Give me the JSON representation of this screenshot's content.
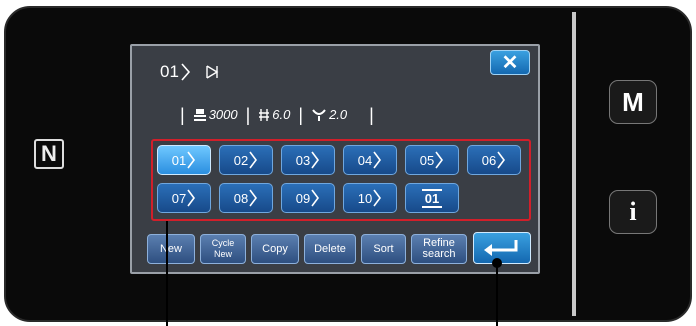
{
  "header": {
    "pattern_number": "01",
    "param_speed": "3000",
    "param_pitch": "6.0",
    "param_tension": "2.0"
  },
  "patterns": [
    {
      "number": "01",
      "selected": true
    },
    {
      "number": "02",
      "selected": false
    },
    {
      "number": "03",
      "selected": false
    },
    {
      "number": "04",
      "selected": false
    },
    {
      "number": "05",
      "selected": false
    },
    {
      "number": "06",
      "selected": false
    },
    {
      "number": "07",
      "selected": false
    },
    {
      "number": "08",
      "selected": false
    },
    {
      "number": "09",
      "selected": false
    },
    {
      "number": "10",
      "selected": false
    },
    {
      "number": "01",
      "selected": false,
      "kind": "cycle"
    }
  ],
  "toolbar": {
    "new_label": "New",
    "cycle_new_line1": "Cycle",
    "cycle_new_line2": "New",
    "copy_label": "Copy",
    "delete_label": "Delete",
    "sort_label": "Sort",
    "refine_line1": "Refine",
    "refine_line2": "search"
  },
  "side": {
    "mode_label": "M",
    "info_label": "i"
  },
  "nfc_label": "N",
  "close_label": "✕",
  "colors": {
    "panel": "#3a3e45",
    "button_blue": "#2b6fb8",
    "selected_blue": "#6fc8ff",
    "highlight_red": "#d11f2a"
  }
}
